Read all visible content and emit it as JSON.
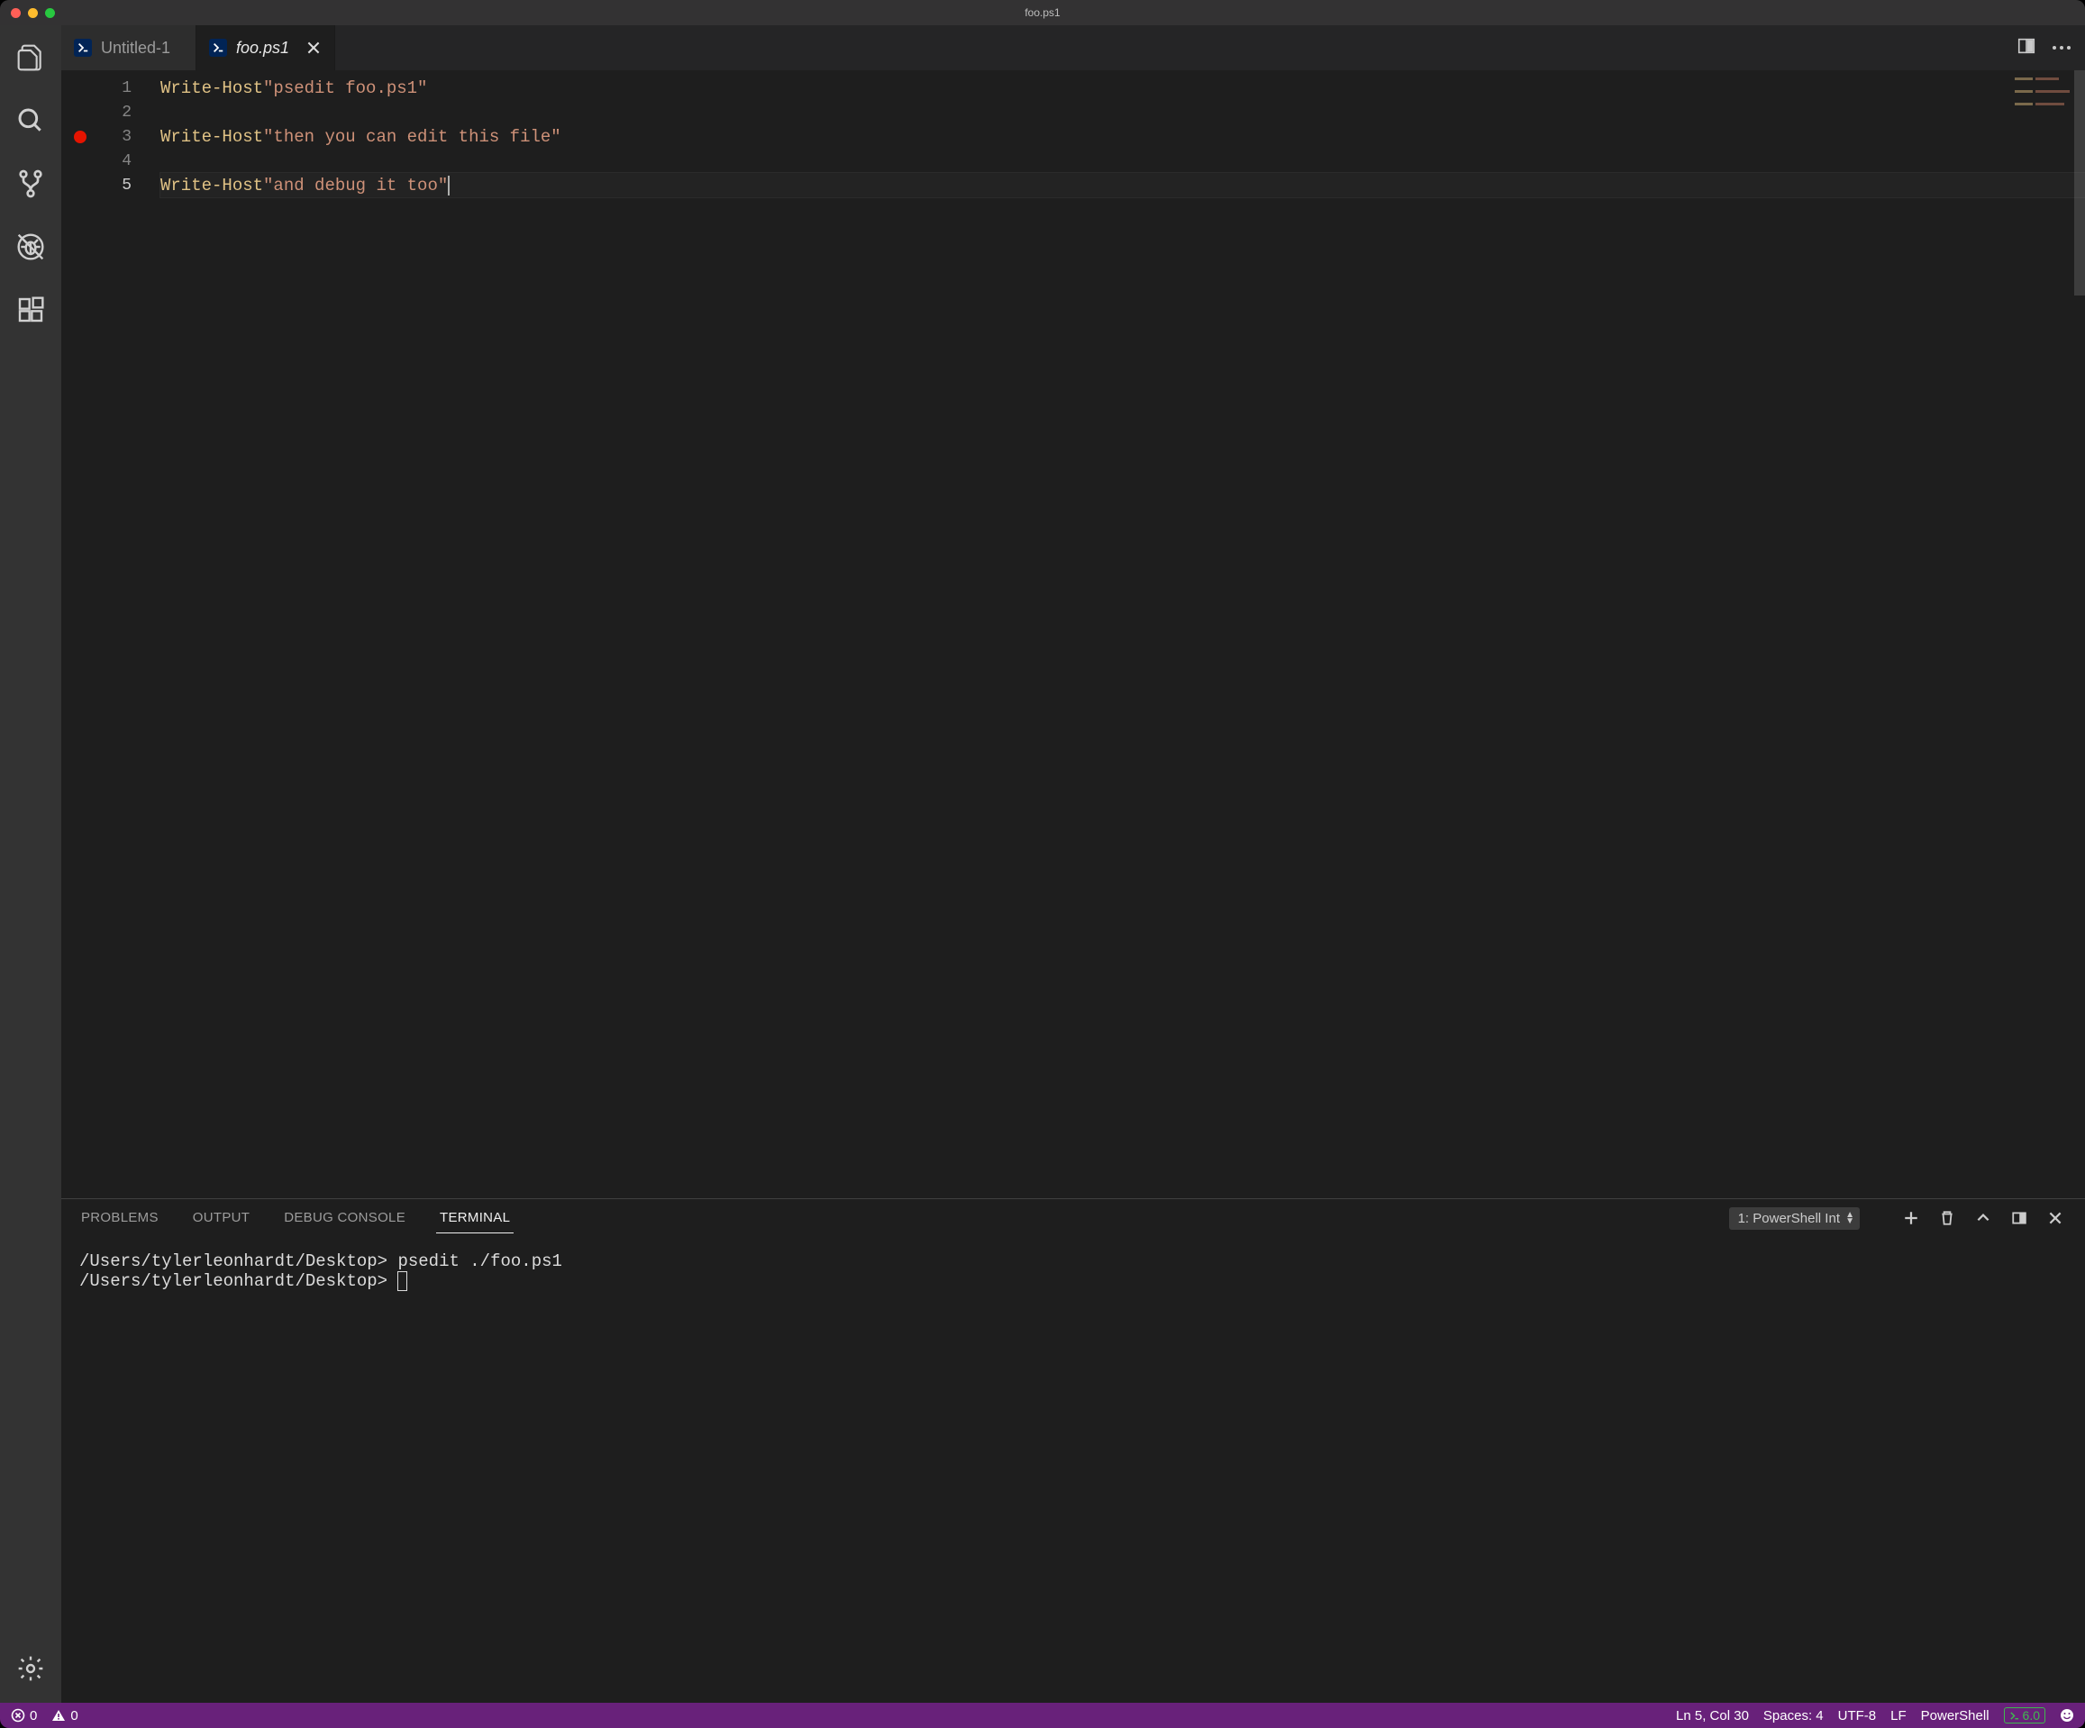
{
  "title": "foo.ps1",
  "tabs": [
    {
      "label": "Untitled-1",
      "active": false
    },
    {
      "label": "foo.ps1",
      "active": true
    }
  ],
  "code": {
    "lines": [
      {
        "n": "1",
        "cmd": "Write-Host",
        "str": "\"psedit foo.ps1\"",
        "bp": false,
        "current": false
      },
      {
        "n": "2",
        "cmd": "",
        "str": "",
        "bp": false,
        "current": false
      },
      {
        "n": "3",
        "cmd": "Write-Host",
        "str": "\"then you can edit this file\"",
        "bp": true,
        "current": false
      },
      {
        "n": "4",
        "cmd": "",
        "str": "",
        "bp": false,
        "current": false
      },
      {
        "n": "5",
        "cmd": "Write-Host",
        "str": "\"and debug it too\"",
        "bp": false,
        "current": true
      }
    ]
  },
  "panel": {
    "tabs": {
      "problems": "PROBLEMS",
      "output": "OUTPUT",
      "debug": "DEBUG CONSOLE",
      "terminal": "TERMINAL"
    },
    "terminalSelector": "1: PowerShell Int",
    "terminal": {
      "line1_prompt": "/Users/tylerleonhardt/Desktop>",
      "line1_cmd": "psedit ./foo.ps1",
      "line2_prompt": "/Users/tylerleonhardt/Desktop>"
    }
  },
  "status": {
    "errors": "0",
    "warnings": "0",
    "lncol": "Ln 5, Col 30",
    "spaces": "Spaces: 4",
    "encoding": "UTF-8",
    "eol": "LF",
    "lang": "PowerShell",
    "psver": "6.0"
  }
}
